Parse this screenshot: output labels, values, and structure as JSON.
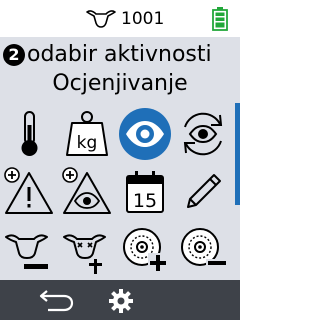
{
  "status": {
    "animal_icon": "cow-head-icon",
    "animal_id": "1001",
    "battery_icon": "battery-full-icon",
    "battery_color": "#22a83a"
  },
  "header": {
    "step_number": "2",
    "title": "odabir aktivnosti",
    "subtitle": "Ocjenjivanje"
  },
  "colors": {
    "background": "#dde0e7",
    "accent": "#1f6fb8",
    "bottom_bar": "#3e4249"
  },
  "activities": [
    {
      "icon": "thermometer-icon",
      "selected": false
    },
    {
      "icon": "weight-kg-icon",
      "label": "kg",
      "selected": false
    },
    {
      "icon": "eye-icon",
      "selected": true
    },
    {
      "icon": "eye-refresh-icon",
      "selected": false
    },
    {
      "icon": "warning-add-icon",
      "selected": false
    },
    {
      "icon": "eye-warning-add-icon",
      "selected": false
    },
    {
      "icon": "calendar-icon",
      "label": "15",
      "selected": false
    },
    {
      "icon": "pencil-icon",
      "selected": false
    },
    {
      "icon": "cow-remove-icon",
      "selected": false
    },
    {
      "icon": "cow-dead-icon",
      "selected": false
    },
    {
      "icon": "tag-add-icon",
      "selected": false
    },
    {
      "icon": "tag-remove-icon",
      "selected": false
    }
  ],
  "footer": {
    "back_icon": "back-arrow-icon",
    "settings_icon": "gear-icon"
  }
}
